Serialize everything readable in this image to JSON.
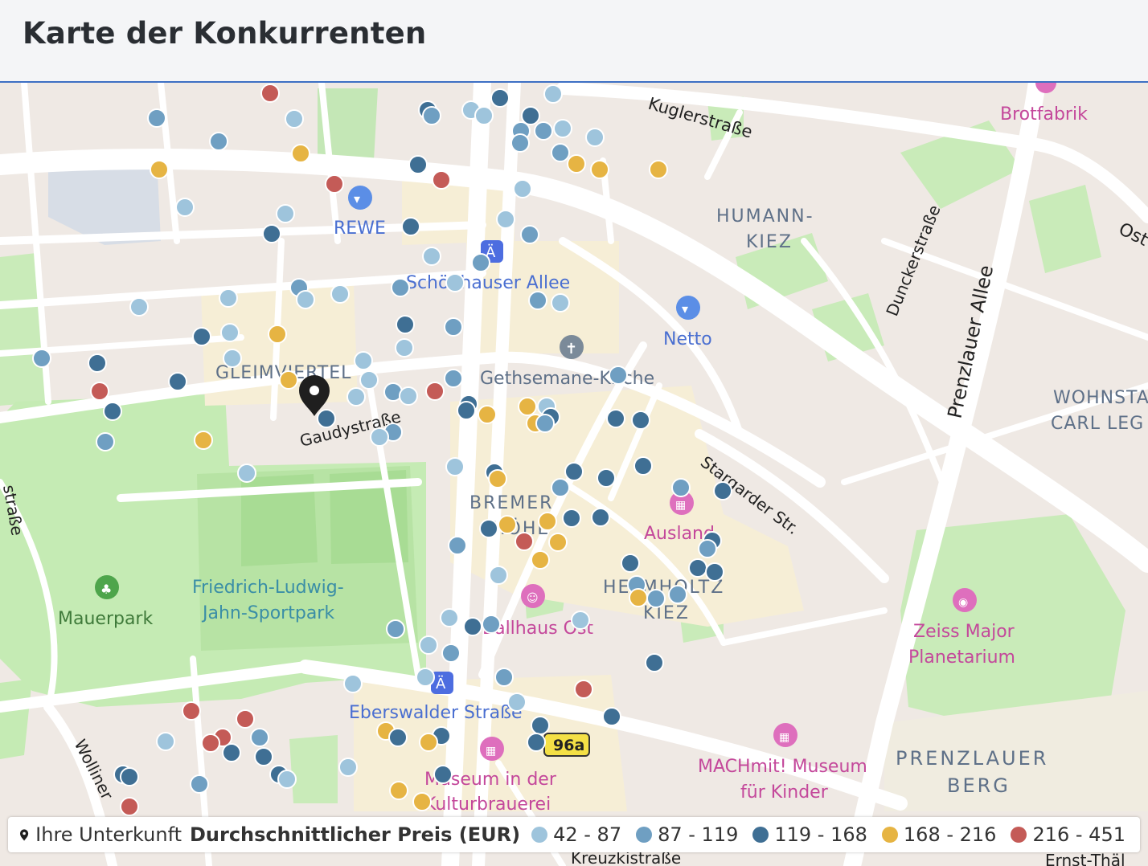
{
  "header": {
    "title": "Karte der Konkurrenten"
  },
  "colors": {
    "c1": "#9ec4dc",
    "c2": "#6f9fc2",
    "c3": "#3f6f94",
    "c4": "#e6b443",
    "c5": "#c45b57"
  },
  "map_labels": {
    "kugler": "Kuglerstraße",
    "brotfabrik": "Brotfabrik",
    "humann1": "HUMANN-",
    "humann2": "KIEZ",
    "rewe": "REWE",
    "schoenhauser": "Schönhauser Allee",
    "netto": "Netto",
    "duncker": "Dunckerstraße",
    "prenzlauerallee": "Prenzlauer Allee",
    "ost": "Ost",
    "gleim": "GLEIMVIERTEL",
    "gethsemane": "Gethsemane-Kirche",
    "wohnstadt1": "WOHNSTA",
    "wohnstadt2": "CARL LEG",
    "gaudy": "Gaudystraße",
    "stargarder": "Stargarder Str.",
    "bremer1": "BREMER",
    "bremer2": "HÖHE",
    "ausland": "Ausland",
    "helmholtz1": "HELMHOLTZ",
    "helmholtz2": "KIEZ",
    "mauerpark": "Mauerpark",
    "jahn1": "Friedrich-Ludwig-",
    "jahn2": "Jahn-Sportpark",
    "ballhaus": "Ballhaus Ost",
    "zeiss1": "Zeiss Major",
    "zeiss2": "Planetarium",
    "eberswalder": "Eberswalder Straße",
    "route": "96a",
    "machmit1": "MACHmit! Museum",
    "machmit2": "für Kinder",
    "prenzlauerberg1": "PRENZLAUER",
    "prenzlauerberg2": "BERG",
    "museum1": "Museum in der",
    "museum2": "Kulturbrauerei",
    "wolliner": "Wolliner",
    "strasse_left": "straße",
    "kastanien": "Kreuzkistraße",
    "ernst": "Ernst-Thäl"
  },
  "legend": {
    "accommodation": "Ihre Unterkunft",
    "title": "Durchschnittlicher Preis (EUR)",
    "ranges": [
      "42 - 87",
      "87 - 119",
      "119 - 168",
      "168 - 216",
      "216 - 451"
    ]
  },
  "competitors": [
    {
      "lon": 195,
      "lat": 147,
      "c": 2
    },
    {
      "lon": 272,
      "lat": 176,
      "c": 2
    },
    {
      "lon": 336,
      "lat": 116,
      "c": 5
    },
    {
      "lon": 366,
      "lat": 148,
      "c": 1
    },
    {
      "lon": 374,
      "lat": 191,
      "c": 4
    },
    {
      "lon": 198,
      "lat": 211,
      "c": 4
    },
    {
      "lon": 416,
      "lat": 229,
      "c": 5
    },
    {
      "lon": 230,
      "lat": 258,
      "c": 1
    },
    {
      "lon": 355,
      "lat": 266,
      "c": 1
    },
    {
      "lon": 338,
      "lat": 291,
      "c": 3
    },
    {
      "lon": 532,
      "lat": 137,
      "c": 3
    },
    {
      "lon": 537,
      "lat": 144,
      "c": 2
    },
    {
      "lon": 586,
      "lat": 137,
      "c": 1
    },
    {
      "lon": 602,
      "lat": 144,
      "c": 1
    },
    {
      "lon": 622,
      "lat": 122,
      "c": 3
    },
    {
      "lon": 688,
      "lat": 117,
      "c": 1
    },
    {
      "lon": 660,
      "lat": 144,
      "c": 3
    },
    {
      "lon": 648,
      "lat": 163,
      "c": 2
    },
    {
      "lon": 647,
      "lat": 178,
      "c": 2
    },
    {
      "lon": 676,
      "lat": 163,
      "c": 2
    },
    {
      "lon": 700,
      "lat": 160,
      "c": 1
    },
    {
      "lon": 740,
      "lat": 171,
      "c": 1
    },
    {
      "lon": 697,
      "lat": 190,
      "c": 2
    },
    {
      "lon": 717,
      "lat": 204,
      "c": 4
    },
    {
      "lon": 746,
      "lat": 211,
      "c": 4
    },
    {
      "lon": 819,
      "lat": 211,
      "c": 4
    },
    {
      "lon": 520,
      "lat": 205,
      "c": 3
    },
    {
      "lon": 549,
      "lat": 224,
      "c": 5
    },
    {
      "lon": 650,
      "lat": 235,
      "c": 1
    },
    {
      "lon": 511,
      "lat": 282,
      "c": 3
    },
    {
      "lon": 629,
      "lat": 273,
      "c": 1
    },
    {
      "lon": 659,
      "lat": 292,
      "c": 2
    },
    {
      "lon": 537,
      "lat": 319,
      "c": 1
    },
    {
      "lon": 598,
      "lat": 327,
      "c": 2
    },
    {
      "lon": 498,
      "lat": 358,
      "c": 2
    },
    {
      "lon": 566,
      "lat": 352,
      "c": 1
    },
    {
      "lon": 173,
      "lat": 382,
      "c": 1
    },
    {
      "lon": 284,
      "lat": 371,
      "c": 1
    },
    {
      "lon": 372,
      "lat": 358,
      "c": 2
    },
    {
      "lon": 380,
      "lat": 373,
      "c": 1
    },
    {
      "lon": 423,
      "lat": 366,
      "c": 1
    },
    {
      "lon": 669,
      "lat": 374,
      "c": 2
    },
    {
      "lon": 697,
      "lat": 377,
      "c": 1
    },
    {
      "lon": 504,
      "lat": 404,
      "c": 3
    },
    {
      "lon": 564,
      "lat": 407,
      "c": 2
    },
    {
      "lon": 251,
      "lat": 419,
      "c": 3
    },
    {
      "lon": 286,
      "lat": 414,
      "c": 1
    },
    {
      "lon": 345,
      "lat": 416,
      "c": 4
    },
    {
      "lon": 503,
      "lat": 433,
      "c": 1
    },
    {
      "lon": 52,
      "lat": 446,
      "c": 2
    },
    {
      "lon": 121,
      "lat": 452,
      "c": 3
    },
    {
      "lon": 289,
      "lat": 446,
      "c": 1
    },
    {
      "lon": 452,
      "lat": 449,
      "c": 1
    },
    {
      "lon": 221,
      "lat": 475,
      "c": 3
    },
    {
      "lon": 359,
      "lat": 473,
      "c": 4
    },
    {
      "lon": 459,
      "lat": 473,
      "c": 1
    },
    {
      "lon": 564,
      "lat": 471,
      "c": 2
    },
    {
      "lon": 769,
      "lat": 467,
      "c": 2
    },
    {
      "lon": 124,
      "lat": 487,
      "c": 5
    },
    {
      "lon": 443,
      "lat": 494,
      "c": 1
    },
    {
      "lon": 489,
      "lat": 488,
      "c": 2
    },
    {
      "lon": 508,
      "lat": 493,
      "c": 1
    },
    {
      "lon": 541,
      "lat": 487,
      "c": 5
    },
    {
      "lon": 140,
      "lat": 512,
      "c": 3
    },
    {
      "lon": 406,
      "lat": 521,
      "c": 3
    },
    {
      "lon": 583,
      "lat": 503,
      "c": 3
    },
    {
      "lon": 580,
      "lat": 511,
      "c": 3
    },
    {
      "lon": 606,
      "lat": 516,
      "c": 4
    },
    {
      "lon": 656,
      "lat": 506,
      "c": 4
    },
    {
      "lon": 680,
      "lat": 506,
      "c": 1
    },
    {
      "lon": 666,
      "lat": 527,
      "c": 4
    },
    {
      "lon": 685,
      "lat": 519,
      "c": 3
    },
    {
      "lon": 678,
      "lat": 527,
      "c": 2
    },
    {
      "lon": 766,
      "lat": 521,
      "c": 3
    },
    {
      "lon": 797,
      "lat": 523,
      "c": 3
    },
    {
      "lon": 131,
      "lat": 550,
      "c": 2
    },
    {
      "lon": 253,
      "lat": 548,
      "c": 4
    },
    {
      "lon": 489,
      "lat": 538,
      "c": 2
    },
    {
      "lon": 472,
      "lat": 544,
      "c": 1
    },
    {
      "lon": 566,
      "lat": 581,
      "c": 1
    },
    {
      "lon": 307,
      "lat": 589,
      "c": 1
    },
    {
      "lon": 615,
      "lat": 588,
      "c": 3
    },
    {
      "lon": 619,
      "lat": 596,
      "c": 4
    },
    {
      "lon": 714,
      "lat": 587,
      "c": 3
    },
    {
      "lon": 754,
      "lat": 595,
      "c": 3
    },
    {
      "lon": 800,
      "lat": 580,
      "c": 3
    },
    {
      "lon": 697,
      "lat": 607,
      "c": 2
    },
    {
      "lon": 847,
      "lat": 607,
      "c": 2
    },
    {
      "lon": 899,
      "lat": 611,
      "c": 3
    },
    {
      "lon": 608,
      "lat": 658,
      "c": 3
    },
    {
      "lon": 631,
      "lat": 653,
      "c": 4
    },
    {
      "lon": 681,
      "lat": 649,
      "c": 4
    },
    {
      "lon": 711,
      "lat": 645,
      "c": 3
    },
    {
      "lon": 747,
      "lat": 644,
      "c": 3
    },
    {
      "lon": 652,
      "lat": 674,
      "c": 5
    },
    {
      "lon": 694,
      "lat": 675,
      "c": 4
    },
    {
      "lon": 569,
      "lat": 679,
      "c": 2
    },
    {
      "lon": 886,
      "lat": 673,
      "c": 3
    },
    {
      "lon": 880,
      "lat": 683,
      "c": 2
    },
    {
      "lon": 672,
      "lat": 697,
      "c": 4
    },
    {
      "lon": 784,
      "lat": 701,
      "c": 3
    },
    {
      "lon": 868,
      "lat": 707,
      "c": 3
    },
    {
      "lon": 889,
      "lat": 712,
      "c": 3
    },
    {
      "lon": 620,
      "lat": 716,
      "c": 1
    },
    {
      "lon": 792,
      "lat": 728,
      "c": 2
    },
    {
      "lon": 794,
      "lat": 744,
      "c": 4
    },
    {
      "lon": 816,
      "lat": 745,
      "c": 2
    },
    {
      "lon": 843,
      "lat": 740,
      "c": 2
    },
    {
      "lon": 559,
      "lat": 769,
      "c": 1
    },
    {
      "lon": 588,
      "lat": 780,
      "c": 3
    },
    {
      "lon": 611,
      "lat": 777,
      "c": 2
    },
    {
      "lon": 722,
      "lat": 772,
      "c": 1
    },
    {
      "lon": 492,
      "lat": 783,
      "c": 2
    },
    {
      "lon": 533,
      "lat": 803,
      "c": 1
    },
    {
      "lon": 561,
      "lat": 813,
      "c": 2
    },
    {
      "lon": 814,
      "lat": 825,
      "c": 3
    },
    {
      "lon": 529,
      "lat": 843,
      "c": 1
    },
    {
      "lon": 627,
      "lat": 843,
      "c": 2
    },
    {
      "lon": 439,
      "lat": 851,
      "c": 1
    },
    {
      "lon": 726,
      "lat": 858,
      "c": 5
    },
    {
      "lon": 643,
      "lat": 874,
      "c": 1
    },
    {
      "lon": 238,
      "lat": 885,
      "c": 5
    },
    {
      "lon": 305,
      "lat": 895,
      "c": 5
    },
    {
      "lon": 761,
      "lat": 892,
      "c": 3
    },
    {
      "lon": 672,
      "lat": 903,
      "c": 3
    },
    {
      "lon": 480,
      "lat": 910,
      "c": 4
    },
    {
      "lon": 495,
      "lat": 918,
      "c": 3
    },
    {
      "lon": 549,
      "lat": 916,
      "c": 3
    },
    {
      "lon": 533,
      "lat": 924,
      "c": 4
    },
    {
      "lon": 667,
      "lat": 924,
      "c": 3
    },
    {
      "lon": 206,
      "lat": 923,
      "c": 1
    },
    {
      "lon": 277,
      "lat": 918,
      "c": 5
    },
    {
      "lon": 262,
      "lat": 925,
      "c": 5
    },
    {
      "lon": 323,
      "lat": 918,
      "c": 2
    },
    {
      "lon": 288,
      "lat": 937,
      "c": 3
    },
    {
      "lon": 328,
      "lat": 942,
      "c": 3
    },
    {
      "lon": 433,
      "lat": 955,
      "c": 1
    },
    {
      "lon": 551,
      "lat": 964,
      "c": 3
    },
    {
      "lon": 153,
      "lat": 964,
      "c": 3
    },
    {
      "lon": 161,
      "lat": 967,
      "c": 3
    },
    {
      "lon": 347,
      "lat": 964,
      "c": 3
    },
    {
      "lon": 357,
      "lat": 970,
      "c": 1
    },
    {
      "lon": 248,
      "lat": 976,
      "c": 2
    },
    {
      "lon": 496,
      "lat": 984,
      "c": 4
    },
    {
      "lon": 525,
      "lat": 998,
      "c": 4
    },
    {
      "lon": 161,
      "lat": 1004,
      "c": 5
    },
    {
      "lon": 190,
      "lat": 1014,
      "c": 2
    },
    {
      "lon": 422,
      "lat": 1014,
      "c": 1
    }
  ]
}
